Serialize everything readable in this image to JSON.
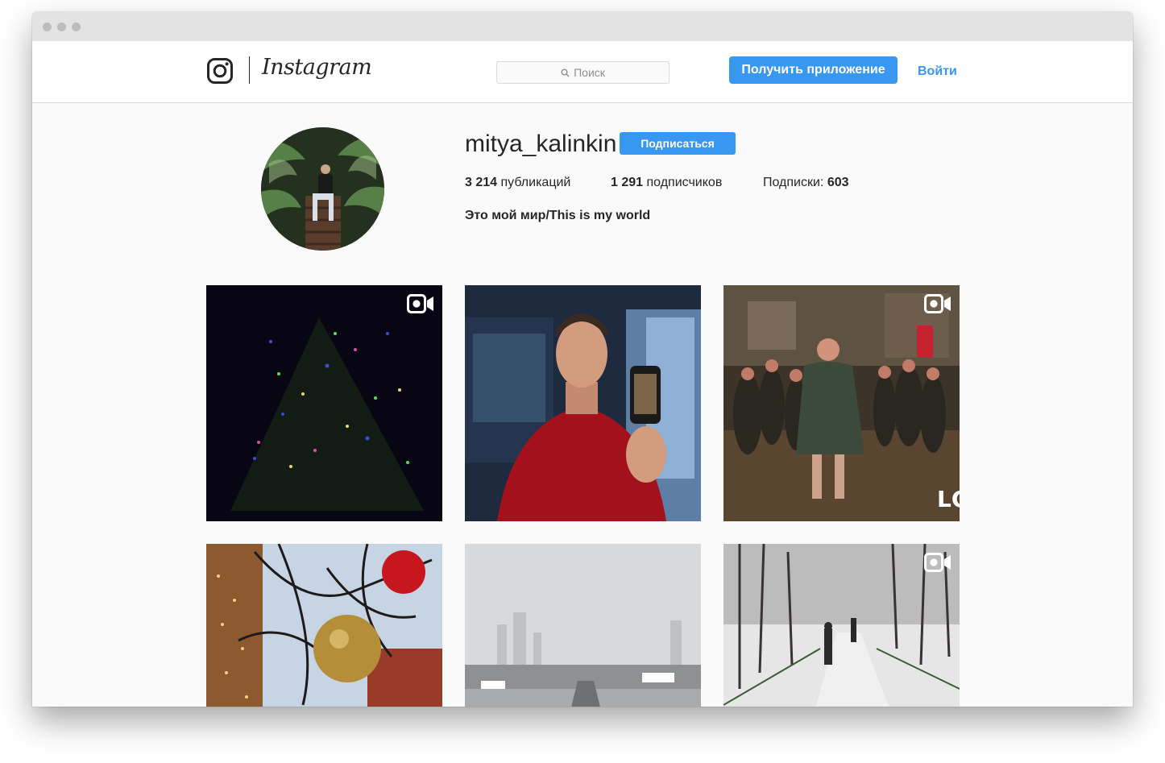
{
  "nav": {
    "brand": "Instagram",
    "search_placeholder": "Поиск",
    "get_app": "Получить приложение",
    "login": "Войти"
  },
  "profile": {
    "username": "mitya_kalinkin",
    "follow_label": "Подписаться",
    "posts": {
      "count": "3 214",
      "label": "публикаций"
    },
    "followers": {
      "count": "1 291",
      "label": "подписчиков"
    },
    "following": {
      "label": "Подписки:",
      "count": "603"
    },
    "bio": "Это мой мир/This is my world"
  },
  "grid": {
    "posts": [
      {
        "type": "video",
        "icon": "video-camera-icon"
      },
      {
        "type": "photo"
      },
      {
        "type": "video",
        "icon": "video-camera-icon",
        "overlay_text": "LC"
      },
      {
        "type": "photo"
      },
      {
        "type": "photo"
      },
      {
        "type": "video",
        "icon": "video-camera-icon"
      }
    ]
  },
  "colors": {
    "accent": "#3897f0",
    "text": "#262626",
    "background": "#fafafa"
  }
}
